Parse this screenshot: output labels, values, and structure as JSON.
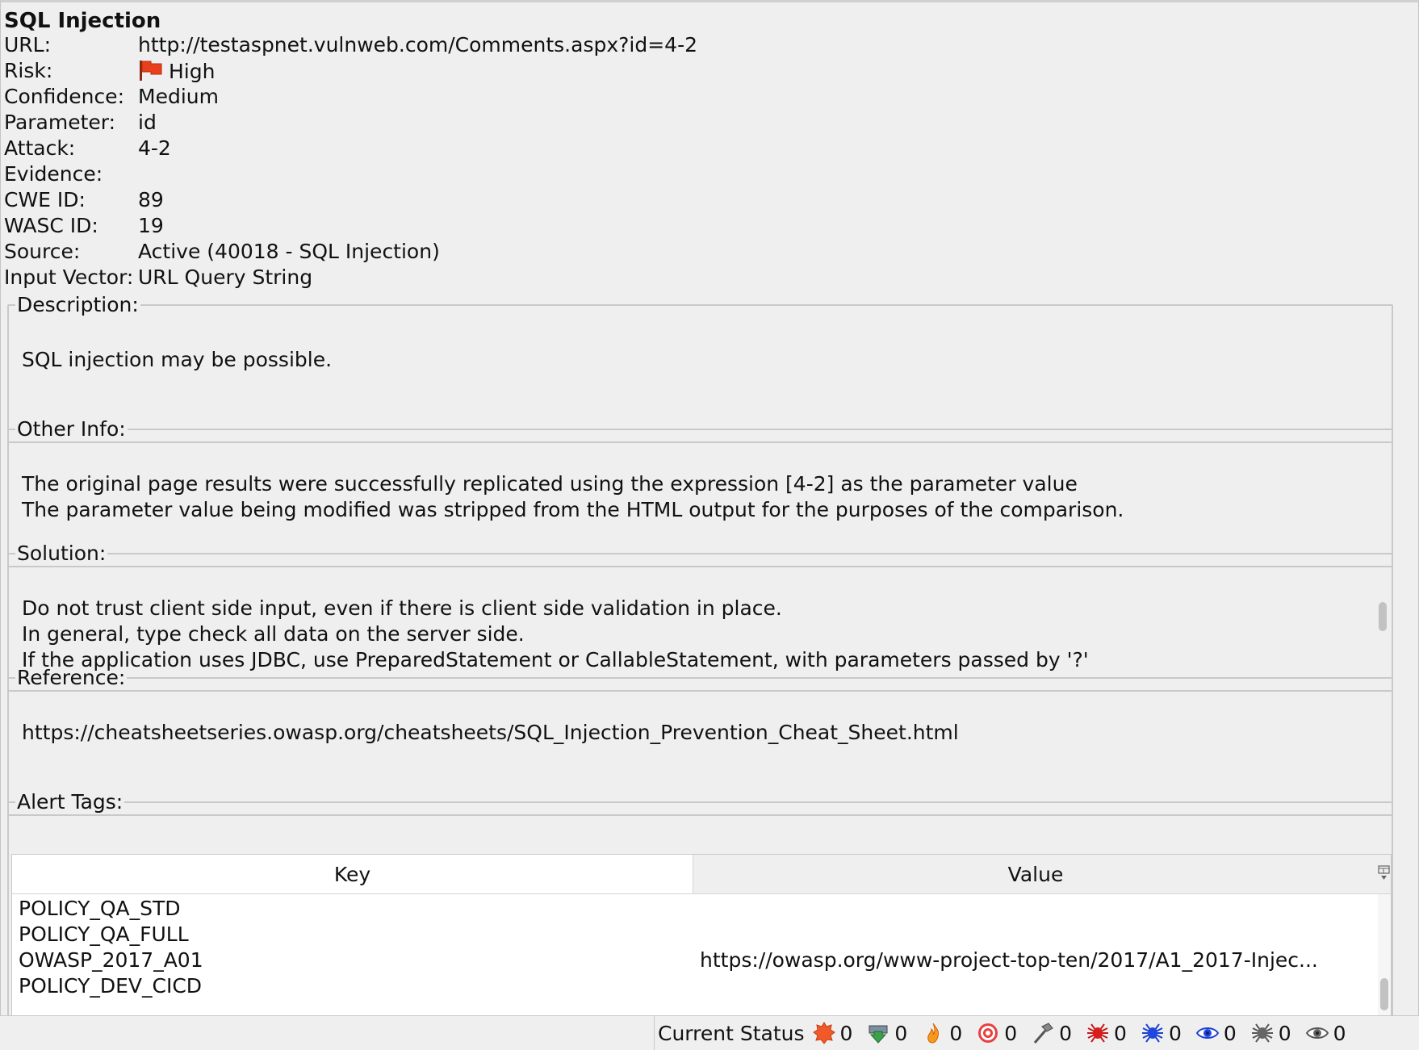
{
  "alert": {
    "title": "SQL Injection",
    "fields": {
      "url_label": "URL:",
      "url_value": "http://testaspnet.vulnweb.com/Comments.aspx?id=4-2",
      "risk_label": "Risk:",
      "risk_value": "High",
      "confidence_label": "Confidence:",
      "confidence_value": "Medium",
      "parameter_label": "Parameter:",
      "parameter_value": "id",
      "attack_label": "Attack:",
      "attack_value": "4-2",
      "evidence_label": "Evidence:",
      "evidence_value": "",
      "cwe_label": "CWE ID:",
      "cwe_value": "89",
      "wasc_label": "WASC ID:",
      "wasc_value": "19",
      "source_label": "Source:",
      "source_value": "Active (40018 - SQL Injection)",
      "input_vector_label": "Input Vector:",
      "input_vector_value": "URL Query String"
    },
    "description": {
      "legend": "Description:",
      "lines": [
        "SQL injection may be possible."
      ]
    },
    "other_info": {
      "legend": "Other Info:",
      "lines": [
        "The original page results were successfully replicated using the expression [4-2] as the parameter value",
        "The parameter value being modified was stripped from the HTML output for the purposes of the comparison."
      ]
    },
    "solution": {
      "legend": "Solution:",
      "lines": [
        "Do not trust client side input, even if there is client side validation in place.",
        "In general, type check all data on the server side.",
        "If the application uses JDBC, use PreparedStatement or CallableStatement, with parameters passed by '?'"
      ]
    },
    "reference": {
      "legend": "Reference:",
      "lines": [
        "https://cheatsheetseries.owasp.org/cheatsheets/SQL_Injection_Prevention_Cheat_Sheet.html"
      ]
    },
    "alert_tags": {
      "legend": "Alert Tags:",
      "columns": [
        "Key",
        "Value"
      ],
      "rows": [
        {
          "key": "POLICY_QA_STD",
          "value": ""
        },
        {
          "key": "POLICY_QA_FULL",
          "value": ""
        },
        {
          "key": "OWASP_2017_A01",
          "value": "https://owasp.org/www-project-top-ten/2017/A1_2017-Injec..."
        },
        {
          "key": "POLICY_DEV_CICD",
          "value": ""
        }
      ]
    }
  },
  "status_bar": {
    "label": "Current Status",
    "items": [
      {
        "icon": "alert-burst-icon",
        "count": "0"
      },
      {
        "icon": "download-arrow-icon",
        "count": "0"
      },
      {
        "icon": "flame-icon",
        "count": "0"
      },
      {
        "icon": "target-icon",
        "count": "0"
      },
      {
        "icon": "hammer-icon",
        "count": "0"
      },
      {
        "icon": "red-spider-icon",
        "count": "0"
      },
      {
        "icon": "blue-spider-icon",
        "count": "0"
      },
      {
        "icon": "eye-icon",
        "count": "0"
      },
      {
        "icon": "gray-spider-icon",
        "count": "0"
      },
      {
        "icon": "gray-eye-icon",
        "count": "0"
      }
    ]
  },
  "colors": {
    "risk_flag": "#e8401c",
    "panel_bg": "#efefef",
    "border": "#c9c9c9"
  }
}
